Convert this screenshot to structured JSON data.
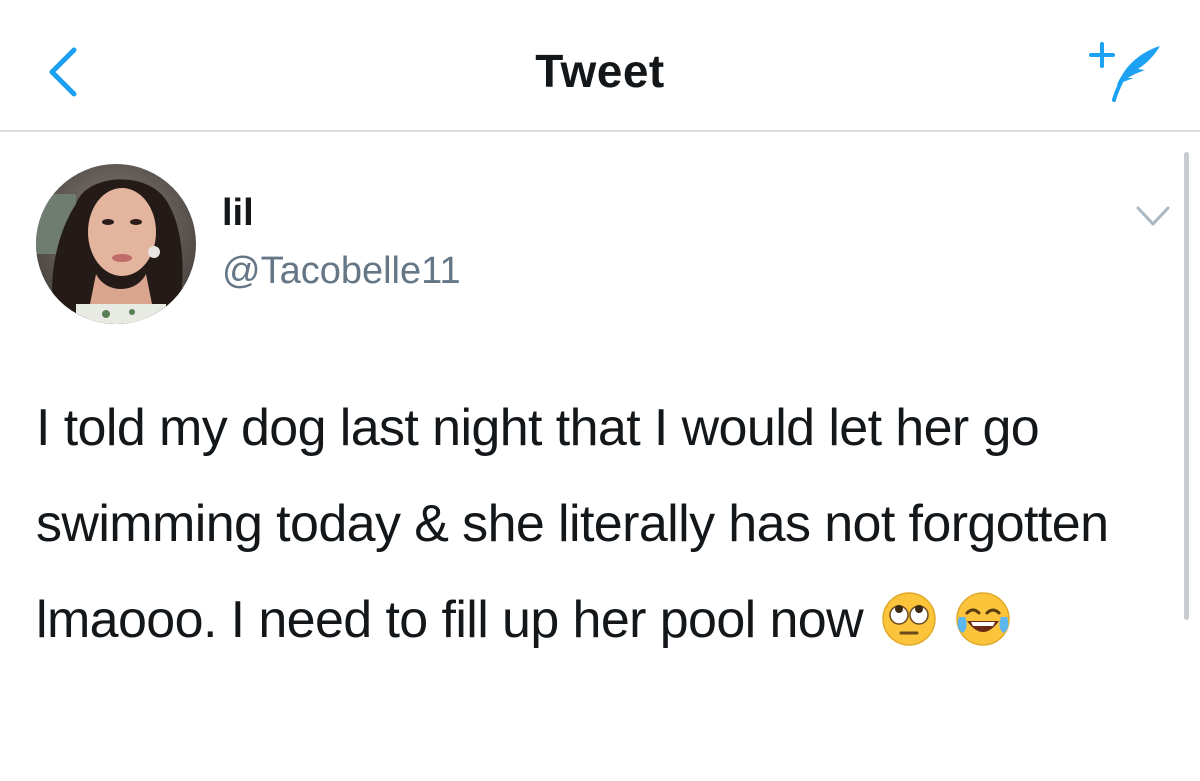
{
  "header": {
    "title": "Tweet",
    "back_icon": "chevron-left-icon",
    "compose_icon": "compose-tweet-icon"
  },
  "tweet": {
    "display_name": "lil",
    "handle": "@Tacobelle11",
    "text": "I told my dog last night that I would let her go swimming today & she literally has not forgotten lmaooo. I need to fill up her pool now",
    "emojis": [
      "face-with-rolling-eyes",
      "face-with-tears-of-joy"
    ]
  },
  "colors": {
    "accent": "#1da1f2",
    "text": "#14171a",
    "secondary_text": "#657786",
    "divider": "#d9dde1"
  }
}
